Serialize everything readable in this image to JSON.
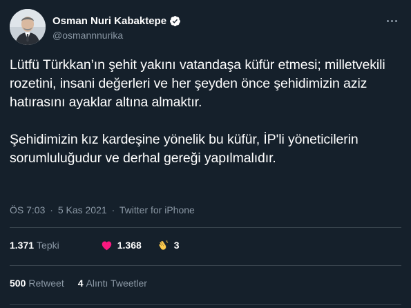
{
  "author": {
    "name": "Osman Nuri Kabaktepe",
    "handle": "@osmannnurika",
    "verified": true,
    "avatar_icon": "profile-photo"
  },
  "tweet": {
    "paragraphs": [
      "Lütfü Türkkan’ın şehit yakını vatandaşa küfür etmesi; milletvekili rozetini, insani değerleri ve her şeyden önce şehidimizin aziz hatırasını ayaklar altına almaktır.",
      "Şehidimizin kız kardeşine yönelik bu küfür, İP'li yöneticilerin sorumluluğudur ve derhal gereği yapılmalıdır."
    ]
  },
  "meta": {
    "time": "ÖS 7:03",
    "date": "5 Kas 2021",
    "separator": "·",
    "source": "Twitter for iPhone"
  },
  "stats": {
    "reactions": {
      "count": "1.371",
      "label": "Tepki"
    },
    "likes": {
      "count": "1.368",
      "icon": "heart-icon"
    },
    "claps": {
      "count": "3",
      "icon": "clapping-hands-icon"
    },
    "retweets": {
      "count": "500",
      "label": "Retweet"
    },
    "quotes": {
      "count": "4",
      "label": "Alıntı Tweetler"
    }
  },
  "colors": {
    "background": "#15202b",
    "text": "#ffffff",
    "secondary": "#8b98a5",
    "divider": "#38444d",
    "verified": "#ffffff",
    "heart": "#f91880",
    "clap": "#ffcc4d"
  }
}
